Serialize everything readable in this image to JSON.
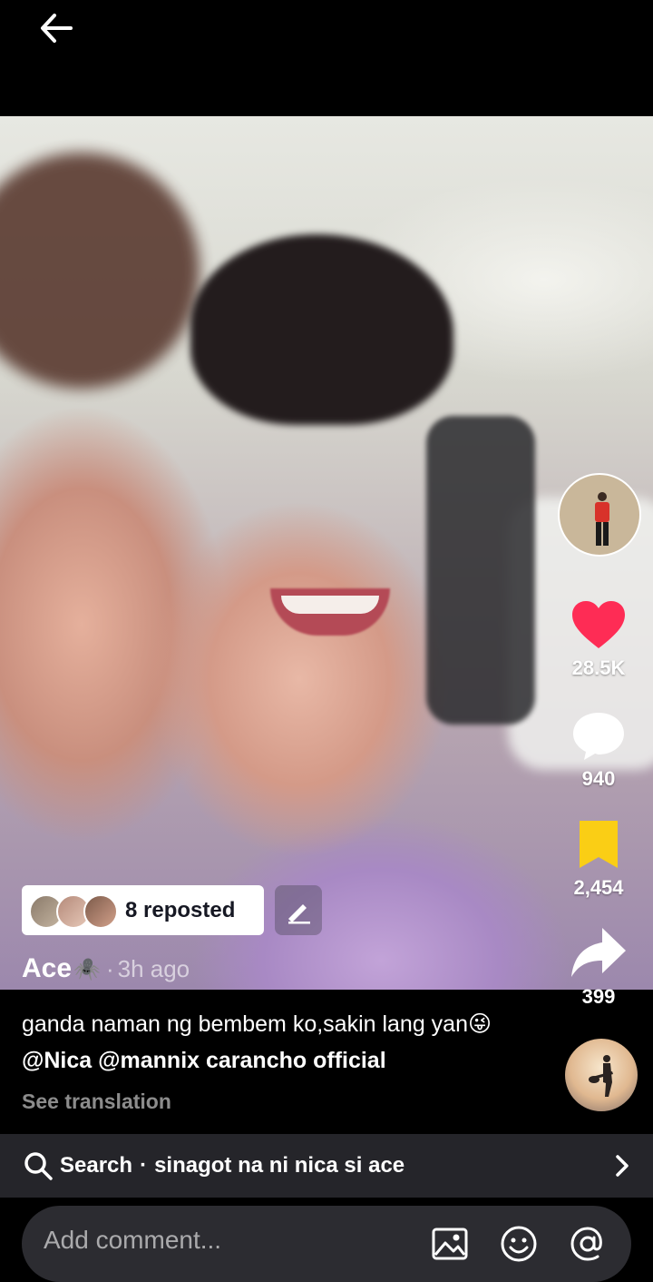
{
  "nav": {
    "back_icon": "arrow-left-icon"
  },
  "video": {
    "description_hidden": ""
  },
  "actions": {
    "likes": "28.5K",
    "comments": "940",
    "saves": "2,454",
    "shares": "399",
    "like_color": "#FE2C55",
    "save_color": "#FACE15"
  },
  "repost": {
    "text": "8 reposted"
  },
  "post": {
    "author": "Ace",
    "author_emoji": "🕷️",
    "separator": "·",
    "time": "3h ago",
    "caption_text": "ganda naman ng bembem ko,sakin lang yan",
    "caption_emoji": "😜",
    "mention_1": "@Nica",
    "mention_2": "@mannix carancho official",
    "see_translation": "See translation"
  },
  "search": {
    "label": "Search",
    "separator": "·",
    "query": "sinagot na ni nica si ace"
  },
  "comment": {
    "placeholder": "Add comment..."
  }
}
